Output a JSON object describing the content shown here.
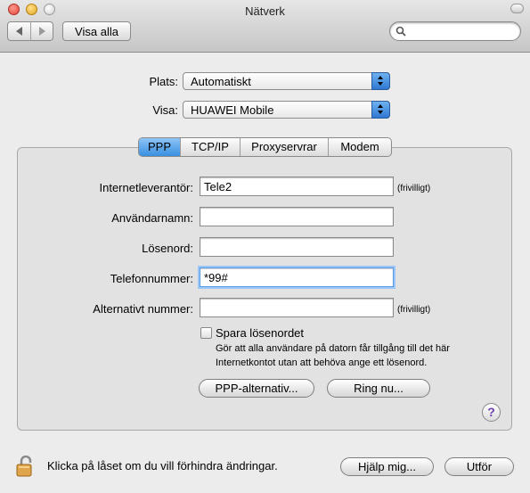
{
  "window": {
    "title": "Nätverk"
  },
  "toolbar": {
    "show_all": "Visa alla",
    "search_placeholder": ""
  },
  "location": {
    "label": "Plats:",
    "value": "Automatiskt"
  },
  "show": {
    "label": "Visa:",
    "value": "HUAWEI Mobile"
  },
  "tabs": [
    {
      "label": "PPP",
      "active": true
    },
    {
      "label": "TCP/IP",
      "active": false
    },
    {
      "label": "Proxyservrar",
      "active": false
    },
    {
      "label": "Modem",
      "active": false
    }
  ],
  "form": {
    "provider": {
      "label": "Internetleverantör:",
      "value": "Tele2",
      "optional": "(frivilligt)"
    },
    "username": {
      "label": "Användarnamn:",
      "value": ""
    },
    "password": {
      "label": "Lösenord:",
      "value": ""
    },
    "phone": {
      "label": "Telefonnummer:",
      "value": "*99#"
    },
    "alt_number": {
      "label": "Alternativt nummer:",
      "value": "",
      "optional": "(frivilligt)"
    },
    "save_password": {
      "label": "Spara lösenordet",
      "checked": false,
      "help": "Gör att alla användare på datorn får tillgång till det här Internetkontot utan att behöva ange ett lösenord."
    }
  },
  "buttons": {
    "ppp_options": "PPP-alternativ...",
    "dial_now": "Ring nu...",
    "help_question": "?",
    "assist": "Hjälp mig...",
    "apply": "Utför"
  },
  "footer": {
    "lock_text": "Klicka på låset om du vill förhindra ändringar."
  },
  "icons": {
    "search": "search-icon",
    "lock": "lock-open-icon",
    "back": "back-arrow-icon",
    "forward": "forward-arrow-icon"
  },
  "colors": {
    "accent": "#3a8fe0"
  }
}
